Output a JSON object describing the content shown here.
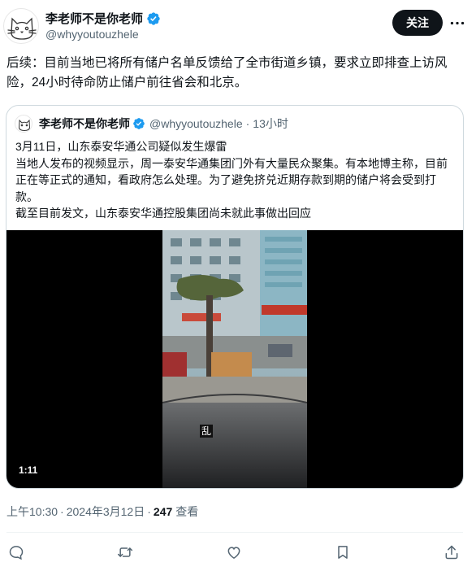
{
  "author": {
    "display_name": "李老师不是你老师",
    "handle": "@whyyoutouzhele",
    "avatar_icon": "cat-sketch-avatar",
    "verified_icon": "verified-badge-icon"
  },
  "header": {
    "follow_label": "关注",
    "more_icon": "more-dots-icon"
  },
  "tweet": {
    "text": "后续：目前当地已将所有储户名单反馈给了全市街道乡镇，要求立即排查上访风险，24小时待命防止储户前往省会和北京。"
  },
  "quote": {
    "display_name": "李老师不是你老师",
    "handle": "@whyyoutouzhele",
    "separator": "·",
    "time": "13小时",
    "lines": [
      "3月11日，山东泰安华通公司疑似发生爆雷",
      "当地人发布的视频显示，周一泰安华通集团门外有大量民众聚集。有本地博主称，目前正在等正式的通知，看政府怎么处理。为了避免挤兑近期存款到期的储户将会受到打款。",
      "截至目前发文，山东泰安华通控股集团尚未就此事做出回应"
    ],
    "video": {
      "duration": "1:11",
      "subtitle": "乱"
    }
  },
  "meta": {
    "time": "上午10:30",
    "separator": "·",
    "date": "2024年3月12日",
    "views_count": "247",
    "views_label": "查看"
  },
  "actions": {
    "reply_icon": "reply-icon",
    "retweet_icon": "retweet-icon",
    "like_icon": "like-icon",
    "bookmark_icon": "bookmark-icon",
    "share_icon": "share-icon"
  },
  "colors": {
    "text": "#0f1419",
    "secondary": "#536471",
    "verified": "#1d9bf0",
    "border": "#cfd9de",
    "follow_bg": "#0f1419"
  }
}
